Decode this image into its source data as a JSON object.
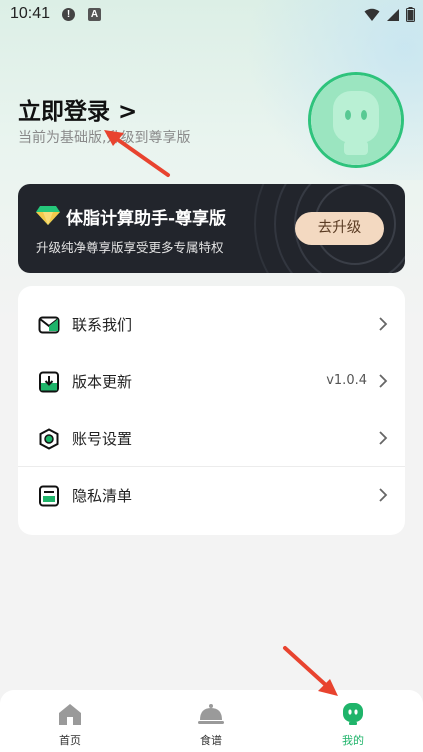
{
  "status_bar": {
    "time": "10:41",
    "notification_icon_1": "!",
    "notification_icon_2": "A"
  },
  "profile": {
    "login_title": "立即登录 >",
    "login_subtitle": "当前为基础版,升级到尊享版"
  },
  "premium_banner": {
    "title": "体脂计算助手-尊享版",
    "description": "升级纯净尊享版享受更多专属特权",
    "upgrade_label": "去升级"
  },
  "menu": {
    "items": [
      {
        "label": "联系我们",
        "value": ""
      },
      {
        "label": "版本更新",
        "value": "v1.0.4"
      },
      {
        "label": "账号设置",
        "value": ""
      },
      {
        "label": "隐私清单",
        "value": ""
      }
    ]
  },
  "bottom_nav": {
    "items": [
      {
        "label": "首页"
      },
      {
        "label": "食谱"
      },
      {
        "label": "我的"
      }
    ]
  },
  "colors": {
    "accent_green": "#1fb46a",
    "banner_dark": "#22252c",
    "upgrade_button": "#f3d9c1",
    "annotation_red": "#e8432f"
  }
}
